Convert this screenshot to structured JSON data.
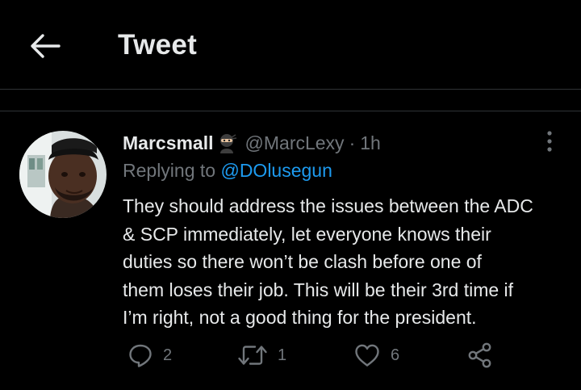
{
  "header": {
    "title": "Tweet",
    "back_icon": "arrow-left-icon"
  },
  "tweet": {
    "author_name": "Marcsmall",
    "author_emoji": "ninja-emoji",
    "handle": "@MarcLexy",
    "separator": "·",
    "time": "1h",
    "replying_prefix": "Replying to",
    "replying_to": "@DOlusegun",
    "text_lines": [
      "They should address the issues between the ADC",
      "& SCP immediately, let everyone knows their",
      "duties so there won’t be clash before one of",
      "them loses their job. This will be their 3rd time if",
      "I’m right, not a good thing for the president."
    ],
    "more_icon": "more-vertical-icon"
  },
  "actions": {
    "reply": {
      "icon": "reply-icon",
      "count": "2"
    },
    "retweet": {
      "icon": "retweet-icon",
      "count": "1"
    },
    "like": {
      "icon": "heart-icon",
      "count": "6"
    },
    "share": {
      "icon": "share-icon"
    }
  },
  "colors": {
    "background": "#000000",
    "text": "#e7e9ea",
    "muted": "#71767b",
    "accent": "#1d9bf0",
    "divider": "#2f3336"
  }
}
